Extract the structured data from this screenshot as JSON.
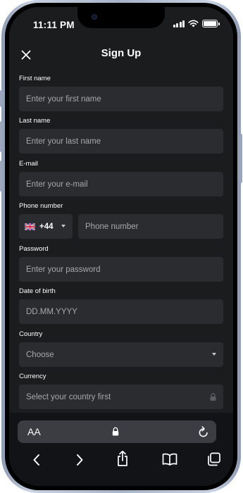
{
  "status_bar": {
    "time": "11:11 PM"
  },
  "header": {
    "title": "Sign Up"
  },
  "form": {
    "first_name": {
      "label": "First name",
      "placeholder": "Enter your first name"
    },
    "last_name": {
      "label": "Last name",
      "placeholder": "Enter your last name"
    },
    "email": {
      "label": "E-mail",
      "placeholder": "Enter your e-mail"
    },
    "phone": {
      "label": "Phone number",
      "country_code": "+44",
      "flag": "uk-flag",
      "placeholder": "Phone number"
    },
    "password": {
      "label": "Password",
      "placeholder": "Enter your password"
    },
    "dob": {
      "label": "Date of birth",
      "placeholder": "DD.MM.YYYY"
    },
    "country": {
      "label": "Country",
      "value": "Choose"
    },
    "currency": {
      "label": "Currency",
      "value": "Select your country first"
    }
  },
  "browser": {
    "text_size_label": "AA",
    "icons": [
      "lock-icon",
      "reload-icon",
      "back-icon",
      "forward-icon",
      "share-icon",
      "bookmarks-icon",
      "tabs-icon"
    ]
  },
  "colors": {
    "screen_bg": "#1b1c1e",
    "input_bg": "#2a2c30",
    "placeholder": "#a5a8ad",
    "text": "#ffffff"
  }
}
